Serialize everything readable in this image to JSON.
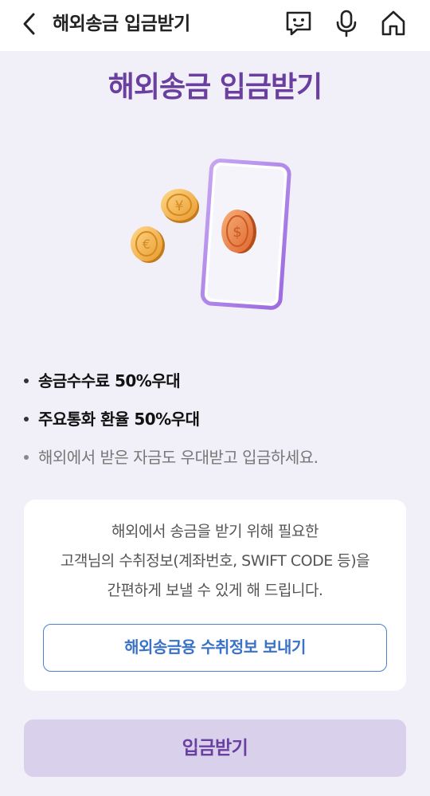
{
  "header": {
    "title": "해외송금 입금받기",
    "back_icon": "chevron-left-icon",
    "chat_icon": "chatbot-face-icon",
    "mic_icon": "microphone-icon",
    "home_icon": "home-icon"
  },
  "main": {
    "title": "해외송금 입금받기",
    "benefits": [
      {
        "text": "송금수수료 50%우대"
      },
      {
        "text": "주요통화 환율 50%우대"
      },
      {
        "text": "해외에서 받은 자금도 우대받고 입금하세요."
      }
    ]
  },
  "info_card": {
    "lines": [
      "해외에서 송금을 받기 위해 필요한",
      "고객님의 수취정보(계좌번호, SWIFT CODE 등)을",
      "간편하게 보낼 수 있게 해 드립니다."
    ],
    "button_label": "해외송금용 수취정보 보내기"
  },
  "footer": {
    "deposit_label": "입금받기"
  },
  "colors": {
    "brand_purple": "#6a3fa0",
    "background": "#f1eff8",
    "link_blue": "#3a72c8",
    "button_bg": "#d9d1ec"
  }
}
